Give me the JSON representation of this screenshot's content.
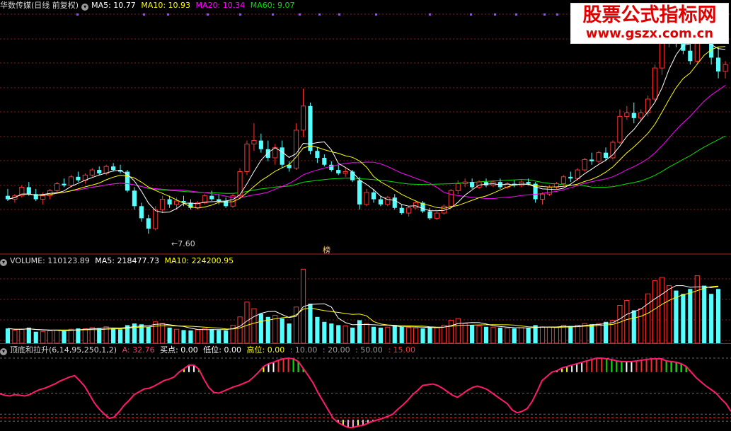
{
  "header_price": {
    "name": "华数传媒(日线 前复权)",
    "ma5": "MA5: 10.77",
    "ma10": "MA10: 10.93",
    "ma20": "MA20: 10.34",
    "ma60": "MA60: 9.07"
  },
  "header_volume": {
    "name": "VOLUME: 110123.89",
    "ma5": "MA5: 218477.73",
    "ma10": "MA10: 224200.95"
  },
  "header_indicator": {
    "name": "顶底和拉升(6,14,95,250,1,2)",
    "a": "A: 32.76",
    "buy": "买点: 0.00",
    "low": "低位: 0.00",
    "high": "高位: 0.00",
    "l10": ": 10.00",
    "l20": ": 20.00",
    "l50": ": 50.00",
    "l15": ": 15.00"
  },
  "annotations": {
    "low_price_label": "←7.60",
    "rank_label": "榜"
  },
  "watermark": {
    "line1": "股票公式指标网",
    "line2": "www.gszx.com.cn"
  },
  "colors": {
    "up": "#ff3232",
    "down": "#54ffff",
    "ma5": "#ffffff",
    "ma10": "#ffff00",
    "ma20": "#ff00ff",
    "ma60": "#00e000",
    "grid": "#8b1a1a",
    "indicator_line": "#ff1a6e"
  },
  "chart_data": [
    {
      "type": "candlestick",
      "panel": "price",
      "title": "华数传媒(日线 前复权)",
      "ylim": [
        7.3,
        14.0
      ],
      "low_marker": 7.6,
      "ohlc": [
        [
          8.7,
          8.9,
          8.55,
          8.6
        ],
        [
          8.6,
          8.75,
          8.5,
          8.7
        ],
        [
          8.7,
          9.0,
          8.65,
          8.95
        ],
        [
          8.95,
          9.1,
          8.7,
          8.75
        ],
        [
          8.75,
          8.9,
          8.55,
          8.6
        ],
        [
          8.6,
          8.8,
          8.45,
          8.7
        ],
        [
          8.7,
          8.9,
          8.6,
          8.85
        ],
        [
          8.85,
          9.1,
          8.8,
          9.05
        ],
        [
          9.05,
          9.2,
          8.95,
          9.0
        ],
        [
          9.0,
          9.3,
          8.95,
          9.25
        ],
        [
          9.25,
          9.4,
          9.1,
          9.15
        ],
        [
          9.15,
          9.35,
          9.05,
          9.3
        ],
        [
          9.3,
          9.5,
          9.25,
          9.45
        ],
        [
          9.45,
          9.55,
          9.3,
          9.35
        ],
        [
          9.35,
          9.6,
          9.3,
          9.55
        ],
        [
          9.55,
          9.65,
          9.4,
          9.45
        ],
        [
          9.45,
          9.6,
          9.35,
          9.4
        ],
        [
          9.4,
          9.45,
          8.8,
          8.85
        ],
        [
          8.85,
          8.95,
          8.3,
          8.4
        ],
        [
          8.4,
          8.5,
          7.95,
          8.05
        ],
        [
          8.05,
          8.15,
          7.6,
          7.75
        ],
        [
          7.75,
          8.4,
          7.7,
          8.3
        ],
        [
          8.3,
          8.7,
          8.2,
          8.6
        ],
        [
          8.6,
          8.7,
          8.35,
          8.45
        ],
        [
          8.45,
          8.65,
          8.3,
          8.55
        ],
        [
          8.55,
          8.7,
          8.4,
          8.5
        ],
        [
          8.5,
          8.6,
          8.3,
          8.35
        ],
        [
          8.35,
          8.55,
          8.3,
          8.5
        ],
        [
          8.5,
          8.75,
          8.45,
          8.7
        ],
        [
          8.7,
          8.85,
          8.55,
          8.6
        ],
        [
          8.6,
          8.75,
          8.45,
          8.55
        ],
        [
          8.55,
          8.65,
          8.35,
          8.4
        ],
        [
          8.4,
          8.75,
          8.35,
          8.7
        ],
        [
          8.7,
          9.5,
          8.65,
          9.4
        ],
        [
          9.4,
          10.3,
          9.3,
          10.2
        ],
        [
          10.2,
          10.8,
          10.0,
          10.3
        ],
        [
          10.3,
          10.5,
          9.95,
          10.05
        ],
        [
          10.05,
          10.3,
          9.7,
          9.8
        ],
        [
          9.8,
          10.2,
          9.6,
          10.1
        ],
        [
          10.1,
          10.3,
          9.5,
          9.6
        ],
        [
          9.6,
          9.7,
          9.4,
          9.5
        ],
        [
          9.5,
          10.8,
          9.45,
          10.6
        ],
        [
          10.6,
          11.8,
          10.4,
          11.3
        ],
        [
          11.3,
          11.4,
          9.9,
          10.0
        ],
        [
          10.0,
          10.1,
          9.65,
          9.8
        ],
        [
          9.8,
          9.9,
          9.55,
          9.6
        ],
        [
          9.6,
          9.7,
          9.4,
          9.45
        ],
        [
          9.45,
          9.6,
          9.3,
          9.35
        ],
        [
          9.35,
          9.5,
          9.25,
          9.4
        ],
        [
          9.4,
          9.45,
          9.1,
          9.15
        ],
        [
          9.15,
          9.25,
          8.3,
          8.45
        ],
        [
          8.45,
          8.9,
          8.4,
          8.8
        ],
        [
          8.8,
          8.9,
          8.5,
          8.6
        ],
        [
          8.6,
          8.7,
          8.4,
          8.45
        ],
        [
          8.45,
          8.7,
          8.4,
          8.65
        ],
        [
          8.65,
          8.75,
          8.3,
          8.35
        ],
        [
          8.35,
          8.45,
          8.15,
          8.2
        ],
        [
          8.2,
          8.4,
          8.1,
          8.35
        ],
        [
          8.35,
          8.55,
          8.3,
          8.5
        ],
        [
          8.5,
          8.55,
          8.2,
          8.25
        ],
        [
          8.25,
          8.35,
          8.0,
          8.05
        ],
        [
          8.05,
          8.25,
          8.0,
          8.2
        ],
        [
          8.2,
          8.45,
          8.15,
          8.4
        ],
        [
          8.4,
          8.9,
          8.35,
          8.85
        ],
        [
          8.85,
          9.15,
          8.75,
          9.05
        ],
        [
          9.05,
          9.2,
          8.95,
          9.1
        ],
        [
          9.1,
          9.2,
          8.9,
          8.95
        ],
        [
          8.95,
          9.15,
          8.9,
          9.1
        ],
        [
          9.1,
          9.2,
          8.95,
          9.0
        ],
        [
          9.0,
          9.15,
          8.95,
          9.1
        ],
        [
          9.1,
          9.2,
          8.9,
          8.95
        ],
        [
          8.95,
          9.1,
          8.9,
          9.05
        ],
        [
          9.05,
          9.15,
          8.95,
          9.0
        ],
        [
          9.0,
          9.15,
          8.95,
          9.1
        ],
        [
          9.1,
          9.2,
          9.0,
          9.05
        ],
        [
          9.05,
          9.1,
          8.5,
          8.6
        ],
        [
          8.6,
          8.8,
          8.45,
          8.75
        ],
        [
          8.75,
          9.0,
          8.7,
          8.95
        ],
        [
          8.95,
          9.1,
          8.9,
          9.05
        ],
        [
          9.05,
          9.3,
          9.0,
          9.25
        ],
        [
          9.25,
          9.4,
          9.1,
          9.2
        ],
        [
          9.2,
          9.5,
          9.15,
          9.45
        ],
        [
          9.45,
          9.8,
          9.4,
          9.75
        ],
        [
          9.75,
          9.95,
          9.6,
          9.7
        ],
        [
          9.7,
          10.0,
          9.65,
          9.95
        ],
        [
          9.95,
          10.1,
          9.7,
          9.8
        ],
        [
          9.8,
          10.3,
          9.75,
          10.25
        ],
        [
          10.25,
          11.2,
          10.2,
          11.0
        ],
        [
          11.0,
          11.3,
          10.9,
          11.1
        ],
        [
          11.1,
          11.4,
          10.8,
          10.95
        ],
        [
          10.95,
          11.2,
          10.85,
          11.1
        ],
        [
          11.1,
          11.6,
          11.0,
          11.5
        ],
        [
          11.5,
          12.5,
          11.4,
          12.4
        ],
        [
          12.4,
          13.4,
          12.2,
          13.2
        ],
        [
          13.2,
          14.0,
          13.0,
          13.6
        ],
        [
          13.6,
          13.7,
          13.0,
          13.2
        ],
        [
          13.2,
          13.3,
          12.8,
          12.9
        ],
        [
          12.9,
          13.1,
          12.5,
          12.6
        ],
        [
          12.6,
          13.8,
          12.5,
          13.7
        ],
        [
          13.7,
          14.0,
          13.4,
          13.5
        ],
        [
          13.5,
          13.6,
          12.5,
          12.7
        ],
        [
          12.7,
          13.0,
          12.1,
          12.3
        ],
        [
          12.3,
          12.6,
          12.1,
          12.5
        ]
      ]
    },
    {
      "type": "bar",
      "panel": "volume",
      "title": "VOLUME",
      "ylim": [
        0,
        460000
      ],
      "values": [
        90000,
        80000,
        85000,
        95000,
        70000,
        72000,
        75000,
        80000,
        78000,
        85000,
        90000,
        88000,
        95000,
        92000,
        100000,
        90000,
        85000,
        110000,
        120000,
        115000,
        100000,
        130000,
        120000,
        95000,
        85000,
        80000,
        78000,
        82000,
        90000,
        85000,
        80000,
        78000,
        110000,
        160000,
        250000,
        210000,
        180000,
        160000,
        170000,
        150000,
        120000,
        220000,
        450000,
        240000,
        160000,
        130000,
        120000,
        110000,
        105000,
        95000,
        140000,
        120000,
        100000,
        95000,
        98000,
        110000,
        100000,
        95000,
        92000,
        90000,
        100000,
        95000,
        110000,
        140000,
        150000,
        120000,
        110000,
        105000,
        100000,
        98000,
        95000,
        92000,
        90000,
        95000,
        92000,
        110000,
        100000,
        98000,
        95000,
        110000,
        105000,
        110000,
        120000,
        115000,
        120000,
        130000,
        140000,
        230000,
        260000,
        200000,
        210000,
        300000,
        380000,
        400000,
        350000,
        320000,
        300000,
        330000,
        410000,
        350000,
        300000,
        330000
      ],
      "ma5": 218477.73,
      "ma10": 224200.95
    },
    {
      "type": "line",
      "panel": "indicator",
      "title": "顶底和拉升(6,14,95,250,1,2)",
      "series": [
        {
          "name": "A",
          "values": [
            49,
            47,
            46,
            48,
            47,
            46,
            48,
            52,
            55,
            57,
            60,
            63,
            67,
            70,
            73,
            75,
            68,
            60,
            48,
            36,
            27,
            20,
            14,
            16,
            24,
            33,
            40,
            48,
            52,
            56,
            57,
            60,
            64,
            68,
            70,
            73,
            80,
            85,
            90,
            90,
            84,
            70,
            58,
            51,
            50,
            53,
            56,
            59,
            61,
            64,
            67,
            73,
            80,
            88,
            92,
            94,
            97,
            99,
            100,
            99,
            95,
            85,
            75,
            64,
            50,
            38,
            26,
            14,
            8,
            4,
            1,
            1,
            3,
            4,
            7,
            10,
            12,
            14,
            17,
            20,
            27,
            33,
            40,
            48,
            54,
            61,
            62,
            63,
            61,
            57,
            52,
            47,
            44,
            49,
            54,
            58,
            60,
            58,
            55,
            50,
            45,
            40,
            35,
            26,
            22,
            24,
            28,
            38,
            52,
            68,
            74,
            80,
            82,
            86,
            88,
            90,
            92,
            94,
            96,
            98,
            100,
            100,
            99,
            98,
            96,
            95,
            95,
            95,
            96,
            97,
            98,
            99,
            99,
            99,
            96,
            95,
            94,
            92,
            88,
            80,
            72,
            66,
            60,
            55,
            50,
            42,
            35,
            24
          ]
        }
      ],
      "ylim": [
        0,
        100
      ],
      "levels": [
        10,
        20,
        50,
        15
      ],
      "current": {
        "A": 32.76,
        "买点": 0.0,
        "低位": 0.0,
        "高位": 0.0
      }
    }
  ]
}
